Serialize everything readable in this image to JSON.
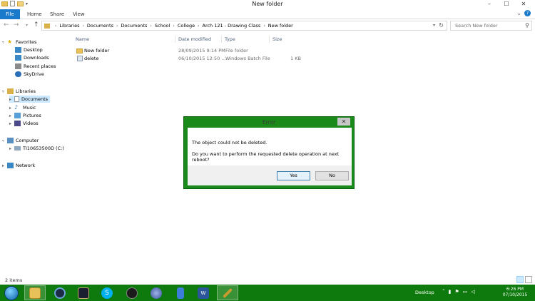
{
  "window": {
    "title": "New folder",
    "controls": {
      "minimize": "–",
      "maximize": "☐",
      "close": "✕"
    }
  },
  "ribbon": {
    "tabs": [
      "File",
      "Home",
      "Share",
      "View"
    ],
    "right_icons": [
      "chevron-down-icon",
      "help-icon"
    ]
  },
  "address_bar": {
    "breadcrumbs": [
      "Libraries",
      "Documents",
      "Documents",
      "School",
      "College",
      "Arch 121 - Drawing Class",
      "New folder"
    ],
    "search_placeholder": "Search New folder"
  },
  "nav_pane": {
    "favorites_label": "Favorites",
    "favorites": [
      "Desktop",
      "Downloads",
      "Recent places",
      "SkyDrive"
    ],
    "libraries_label": "Libraries",
    "libraries": [
      "Documents",
      "Music",
      "Pictures",
      "Videos"
    ],
    "computer_label": "Computer",
    "drive": "TI10653500D (C:)",
    "network_label": "Network"
  },
  "file_list": {
    "columns": [
      "Name",
      "Date modified",
      "Type",
      "Size"
    ],
    "rows": [
      {
        "name": "New folder",
        "date": "28/09/2015 9:14 PM",
        "type": "File folder",
        "size": ""
      },
      {
        "name": "delete",
        "date": "06/10/2015 12:50 ...",
        "type": "Windows Batch File",
        "size": "1 KB"
      }
    ]
  },
  "status_bar": {
    "count": "2 items"
  },
  "dialog": {
    "title": "Error",
    "close": "✕",
    "message1": "The object could not be deleted.",
    "message2": "Do you want to perform the requested delete operation at next reboot?",
    "yes": "Yes",
    "no": "No"
  },
  "taskbar": {
    "desktop_label": "Desktop",
    "time": "6:26 PM",
    "date": "07/10/2015"
  },
  "colors": {
    "accent": "#1979ca",
    "taskbar": "#0e7a0d",
    "dialog_frame": "#1a8a1a"
  }
}
